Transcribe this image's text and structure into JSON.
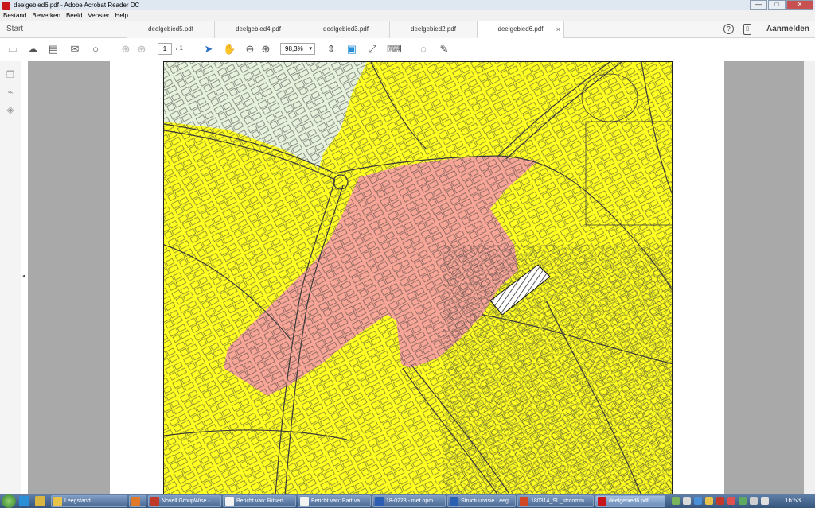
{
  "window": {
    "title": "deelgebied6.pdf - Adobe Acrobat Reader DC",
    "minimize": "—",
    "maximize": "□",
    "close": "✕"
  },
  "menu": [
    "Bestand",
    "Bewerken",
    "Beeld",
    "Venster",
    "Help"
  ],
  "tabs": {
    "start": "Start",
    "items": [
      "deelgebied5.pdf",
      "deelgebied4.pdf",
      "deelgebied3.pdf",
      "deelgebied2.pdf",
      "deelgebied6.pdf"
    ],
    "active_index": 4,
    "close_glyph": "×",
    "help": "?",
    "mobile": "▯",
    "signin": "Aanmelden"
  },
  "toolbar": {
    "icons": [
      "save-icon",
      "upload-icon",
      "print-icon",
      "email-icon",
      "search-icon",
      "prev-page-icon",
      "next-page-icon",
      "select-icon",
      "hand-icon",
      "zoom-out-icon",
      "zoom-in-icon",
      "fit-page-icon",
      "rotate-icon",
      "full-screen-icon",
      "keyboard-icon",
      "comment-icon",
      "sign-icon"
    ],
    "page_current": "1",
    "page_total": "/ 1",
    "zoom": "98,3%",
    "zoom_dd": "▾"
  },
  "nav": {
    "collapse": "◂"
  },
  "map": {
    "colors": {
      "yellow": "#ffff22",
      "salmon": "#f7a596",
      "green": "#e6f1dc",
      "lines": "#3a3a3a"
    }
  },
  "taskbar": {
    "tasks": [
      "Leegstand",
      "",
      "Novell GroupWise -...",
      "Bericht van: Ritsert ...",
      "Bericht van: Bart va...",
      "18-0223 - met opm ...",
      "Structuurvisie Leeg...",
      "180314_SL_stroomm...",
      "deelgebied6.pdf ..."
    ],
    "time": "16:53"
  }
}
